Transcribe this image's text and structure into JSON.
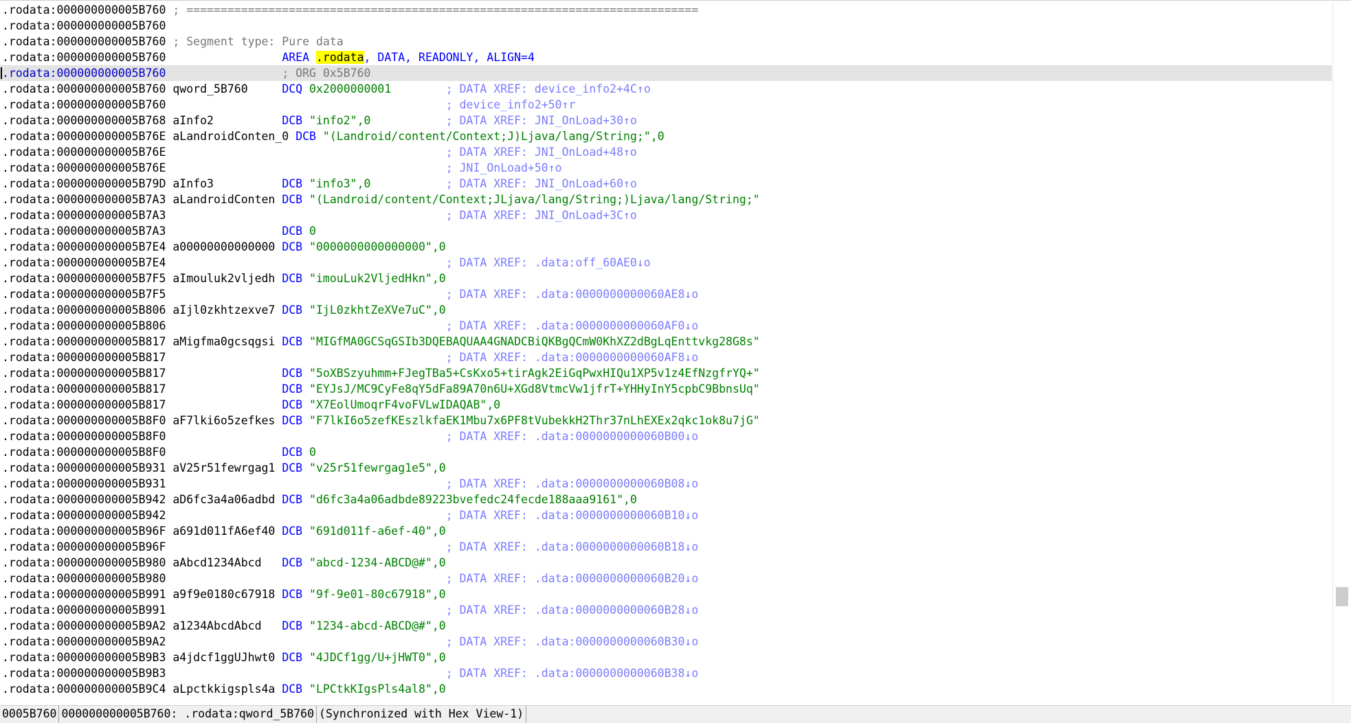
{
  "colors": {
    "address": "#000000",
    "keyword": "#0000ff",
    "string": "#008000",
    "comment": "#777777",
    "xref": "#7b7bff",
    "highlight": "#ffff00",
    "current_line": "#e3e3e3"
  },
  "listing": [
    {
      "addr": ".rodata:000000000005B760",
      "name": "",
      "op": "",
      "args": [],
      "comment": "; ===========================================================================",
      "ctype": "plain"
    },
    {
      "addr": ".rodata:000000000005B760",
      "name": "",
      "op": "",
      "args": [],
      "comment": "",
      "ctype": "plain"
    },
    {
      "addr": ".rodata:000000000005B760",
      "name": "",
      "op": "",
      "args": [],
      "comment": "; Segment type: Pure data",
      "ctype": "plain"
    },
    {
      "addr": ".rodata:000000000005B760",
      "name": "",
      "op": "AREA",
      "args": [
        {
          "t": " ",
          "c": "kw"
        },
        {
          "t": ".rodata",
          "c": "hl"
        },
        {
          "t": ", DATA, READONLY, ALIGN=4",
          "c": "kw"
        }
      ],
      "comment": "",
      "ctype": "plain"
    },
    {
      "addr": ".rodata:000000000005B760",
      "name": "",
      "op": "",
      "args": [],
      "comment": "; ORG 0x5B760",
      "ctype": "plain",
      "current": true
    },
    {
      "addr": ".rodata:000000000005B760",
      "name": "qword_5B760",
      "op": "DCQ",
      "args": [
        {
          "t": " 0x2000000001",
          "c": "num"
        }
      ],
      "comment": "; DATA XREF: device_info2+4C↑o",
      "ctype": "xref"
    },
    {
      "addr": ".rodata:000000000005B760",
      "name": "",
      "op": "",
      "args": [],
      "comment": "; device_info2+50↑r",
      "ctype": "xref"
    },
    {
      "addr": ".rodata:000000000005B768",
      "name": "aInfo2",
      "op": "DCB",
      "args": [
        {
          "t": " \"info2\",0",
          "c": "str"
        }
      ],
      "comment": "; DATA XREF: JNI_OnLoad+30↑o",
      "ctype": "xref"
    },
    {
      "addr": ".rodata:000000000005B76E",
      "name": "aLandroidConten_0",
      "op": "DCB",
      "args": [
        {
          "t": " \"(Landroid/content/Context;J)Ljava/lang/String;\",0",
          "c": "str"
        }
      ],
      "comment": "",
      "ctype": "xref"
    },
    {
      "addr": ".rodata:000000000005B76E",
      "name": "",
      "op": "",
      "args": [],
      "comment": "; DATA XREF: JNI_OnLoad+48↑o",
      "ctype": "xref"
    },
    {
      "addr": ".rodata:000000000005B76E",
      "name": "",
      "op": "",
      "args": [],
      "comment": "; JNI_OnLoad+50↑o",
      "ctype": "xref"
    },
    {
      "addr": ".rodata:000000000005B79D",
      "name": "aInfo3",
      "op": "DCB",
      "args": [
        {
          "t": " \"info3\",0",
          "c": "str"
        }
      ],
      "comment": "; DATA XREF: JNI_OnLoad+60↑o",
      "ctype": "xref"
    },
    {
      "addr": ".rodata:000000000005B7A3",
      "name": "aLandroidConten",
      "op": "DCB",
      "args": [
        {
          "t": " \"(Landroid/content/Context;JLjava/lang/String;)Ljava/lang/String;\"",
          "c": "str"
        }
      ],
      "comment": "",
      "ctype": "xref"
    },
    {
      "addr": ".rodata:000000000005B7A3",
      "name": "",
      "op": "",
      "args": [],
      "comment": "; DATA XREF: JNI_OnLoad+3C↑o",
      "ctype": "xref"
    },
    {
      "addr": ".rodata:000000000005B7A3",
      "name": "",
      "op": "DCB",
      "args": [
        {
          "t": " 0",
          "c": "num"
        }
      ],
      "comment": "",
      "ctype": "xref"
    },
    {
      "addr": ".rodata:000000000005B7E4",
      "name": "a00000000000000",
      "op": "DCB",
      "args": [
        {
          "t": " \"0000000000000000\",0",
          "c": "str"
        }
      ],
      "comment": "",
      "ctype": "xref"
    },
    {
      "addr": ".rodata:000000000005B7E4",
      "name": "",
      "op": "",
      "args": [],
      "comment": "; DATA XREF: .data:off_60AE0↓o",
      "ctype": "xref"
    },
    {
      "addr": ".rodata:000000000005B7F5",
      "name": "aImouluk2vljedh",
      "op": "DCB",
      "args": [
        {
          "t": " \"imouLuk2VljedHkn\",0",
          "c": "str"
        }
      ],
      "comment": "",
      "ctype": "xref"
    },
    {
      "addr": ".rodata:000000000005B7F5",
      "name": "",
      "op": "",
      "args": [],
      "comment": "; DATA XREF: .data:0000000000060AE8↓o",
      "ctype": "xref"
    },
    {
      "addr": ".rodata:000000000005B806",
      "name": "aIjl0zkhtzexve7",
      "op": "DCB",
      "args": [
        {
          "t": " \"IjL0zkhtZeXVe7uC\",0",
          "c": "str"
        }
      ],
      "comment": "",
      "ctype": "xref"
    },
    {
      "addr": ".rodata:000000000005B806",
      "name": "",
      "op": "",
      "args": [],
      "comment": "; DATA XREF: .data:0000000000060AF0↓o",
      "ctype": "xref"
    },
    {
      "addr": ".rodata:000000000005B817",
      "name": "aMigfma0gcsqgsi",
      "op": "DCB",
      "args": [
        {
          "t": " \"MIGfMA0GCSqGSIb3DQEBAQUAA4GNADCBiQKBgQCmW0KhXZ2dBgLqEnttvkg28G8s\"",
          "c": "str"
        }
      ],
      "comment": "",
      "ctype": "xref"
    },
    {
      "addr": ".rodata:000000000005B817",
      "name": "",
      "op": "",
      "args": [],
      "comment": "; DATA XREF: .data:0000000000060AF8↓o",
      "ctype": "xref"
    },
    {
      "addr": ".rodata:000000000005B817",
      "name": "",
      "op": "DCB",
      "args": [
        {
          "t": " \"5oXBSzyuhmm+FJegTBa5+CsKxo5+tirAgk2EiGqPwxHIQu1XP5v1z4EfNzgfrYQ+\"",
          "c": "str"
        }
      ],
      "comment": "",
      "ctype": "xref"
    },
    {
      "addr": ".rodata:000000000005B817",
      "name": "",
      "op": "DCB",
      "args": [
        {
          "t": " \"EYJsJ/MC9CyFe8qY5dFa89A70n6U+XGd8VtmcVw1jfrT+YHHyInY5cpbC9BbnsUq\"",
          "c": "str"
        }
      ],
      "comment": "",
      "ctype": "xref"
    },
    {
      "addr": ".rodata:000000000005B817",
      "name": "",
      "op": "DCB",
      "args": [
        {
          "t": " \"X7EolUmoqrF4voFVLwIDAQAB\",0",
          "c": "str"
        }
      ],
      "comment": "",
      "ctype": "xref"
    },
    {
      "addr": ".rodata:000000000005B8F0",
      "name": "aF7lki6o5zefkes",
      "op": "DCB",
      "args": [
        {
          "t": " \"F7lkI6o5zefKEszlkfaEK1Mbu7x6PF8tVubekkH2Thr37nLhEXEx2qkc1ok8u7jG\"",
          "c": "str"
        }
      ],
      "comment": "",
      "ctype": "xref"
    },
    {
      "addr": ".rodata:000000000005B8F0",
      "name": "",
      "op": "",
      "args": [],
      "comment": "; DATA XREF: .data:0000000000060B00↓o",
      "ctype": "xref"
    },
    {
      "addr": ".rodata:000000000005B8F0",
      "name": "",
      "op": "DCB",
      "args": [
        {
          "t": " 0",
          "c": "num"
        }
      ],
      "comment": "",
      "ctype": "xref"
    },
    {
      "addr": ".rodata:000000000005B931",
      "name": "aV25r51fewrgag1",
      "op": "DCB",
      "args": [
        {
          "t": " \"v25r51fewrgag1e5\",0",
          "c": "str"
        }
      ],
      "comment": "",
      "ctype": "xref"
    },
    {
      "addr": ".rodata:000000000005B931",
      "name": "",
      "op": "",
      "args": [],
      "comment": "; DATA XREF: .data:0000000000060B08↓o",
      "ctype": "xref"
    },
    {
      "addr": ".rodata:000000000005B942",
      "name": "aD6fc3a4a06adbd",
      "op": "DCB",
      "args": [
        {
          "t": " \"d6fc3a4a06adbde89223bvefedc24fecde188aaa9161\",0",
          "c": "str"
        }
      ],
      "comment": "",
      "ctype": "xref"
    },
    {
      "addr": ".rodata:000000000005B942",
      "name": "",
      "op": "",
      "args": [],
      "comment": "; DATA XREF: .data:0000000000060B10↓o",
      "ctype": "xref"
    },
    {
      "addr": ".rodata:000000000005B96F",
      "name": "a691d011fA6ef40",
      "op": "DCB",
      "args": [
        {
          "t": " \"691d011f-a6ef-40\",0",
          "c": "str"
        }
      ],
      "comment": "",
      "ctype": "xref"
    },
    {
      "addr": ".rodata:000000000005B96F",
      "name": "",
      "op": "",
      "args": [],
      "comment": "; DATA XREF: .data:0000000000060B18↓o",
      "ctype": "xref"
    },
    {
      "addr": ".rodata:000000000005B980",
      "name": "aAbcd1234Abcd",
      "op": "DCB",
      "args": [
        {
          "t": " \"abcd-1234-ABCD@#\",0",
          "c": "str"
        }
      ],
      "comment": "",
      "ctype": "xref"
    },
    {
      "addr": ".rodata:000000000005B980",
      "name": "",
      "op": "",
      "args": [],
      "comment": "; DATA XREF: .data:0000000000060B20↓o",
      "ctype": "xref"
    },
    {
      "addr": ".rodata:000000000005B991",
      "name": "a9f9e0180c67918",
      "op": "DCB",
      "args": [
        {
          "t": " \"9f-9e01-80c67918\",0",
          "c": "str"
        }
      ],
      "comment": "",
      "ctype": "xref"
    },
    {
      "addr": ".rodata:000000000005B991",
      "name": "",
      "op": "",
      "args": [],
      "comment": "; DATA XREF: .data:0000000000060B28↓o",
      "ctype": "xref"
    },
    {
      "addr": ".rodata:000000000005B9A2",
      "name": "a1234AbcdAbcd",
      "op": "DCB",
      "args": [
        {
          "t": " \"1234-abcd-ABCD@#\",0",
          "c": "str"
        }
      ],
      "comment": "",
      "ctype": "xref"
    },
    {
      "addr": ".rodata:000000000005B9A2",
      "name": "",
      "op": "",
      "args": [],
      "comment": "; DATA XREF: .data:0000000000060B30↓o",
      "ctype": "xref"
    },
    {
      "addr": ".rodata:000000000005B9B3",
      "name": "a4jdcf1ggUJhwt0",
      "op": "DCB",
      "args": [
        {
          "t": " \"4JDCf1gg/U+jHWT0\",0",
          "c": "str"
        }
      ],
      "comment": "",
      "ctype": "xref"
    },
    {
      "addr": ".rodata:000000000005B9B3",
      "name": "",
      "op": "",
      "args": [],
      "comment": "; DATA XREF: .data:0000000000060B38↓o",
      "ctype": "xref"
    },
    {
      "addr": ".rodata:000000000005B9C4",
      "name": "aLpctkkigspls4a",
      "op": "DCB",
      "args": [
        {
          "t": " \"LPCtkKIgsPls4al8\",0",
          "c": "str"
        }
      ],
      "comment": "",
      "ctype": "xref"
    }
  ],
  "status": {
    "offset": "0005B760",
    "location": "000000000005B760: .rodata:qword_5B760",
    "sync": "(Synchronized with Hex View-1)"
  }
}
